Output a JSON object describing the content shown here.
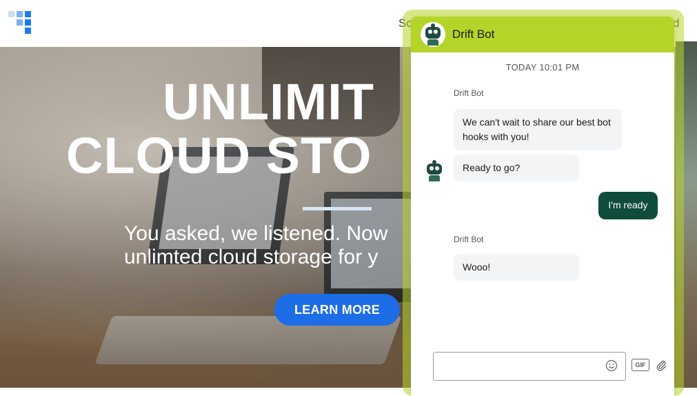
{
  "site": {
    "nav_partial_left": "Sc",
    "nav_partial_right": "d"
  },
  "hero": {
    "headline_line1": "UNLIMIT",
    "headline_line2": "CLOUD STO",
    "subtext_line1": "You asked, we listened. Now",
    "subtext_line2": "unlimted cloud storage for y",
    "cta_label": "LEARN MORE"
  },
  "chat": {
    "header_title": "Drift Bot",
    "timestamp": "TODAY 10:01 PM",
    "messages": [
      {
        "sender": "Drift Bot",
        "text": "We can't wait to share our best bot hooks with you!"
      },
      {
        "text": "Ready to go?"
      },
      {
        "from": "user",
        "text": "I'm ready"
      },
      {
        "sender": "Drift Bot",
        "text": "Wooo!"
      }
    ],
    "composer_value": "",
    "gif_label": "GIF",
    "colors": {
      "header": "#b5d42a",
      "user_bubble": "#0f4c3c",
      "bot_bubble": "#f3f4f6"
    },
    "icons": [
      "robot-avatar-icon",
      "emoji-icon",
      "gif-icon",
      "paperclip-icon"
    ]
  },
  "colors": {
    "brand_blue": "#1d6de6"
  }
}
